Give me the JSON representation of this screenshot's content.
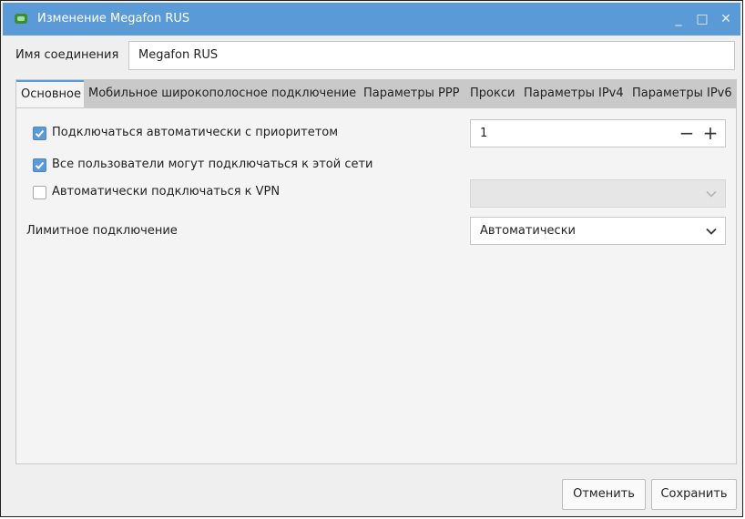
{
  "window": {
    "title": "Изменение Megafon RUS",
    "titlebar_color": "#5a9ad6",
    "controls": {
      "minimize": "_",
      "maximize": "□",
      "close": "✕"
    }
  },
  "connection": {
    "label": "Имя соединения",
    "value": "Megafon RUS"
  },
  "tabs": [
    {
      "label": "Основное",
      "active": true
    },
    {
      "label": "Мобильное широкополосное подключение",
      "active": false
    },
    {
      "label": "Параметры PPP",
      "active": false
    },
    {
      "label": "Прокси",
      "active": false
    },
    {
      "label": "Параметры IPv4",
      "active": false
    },
    {
      "label": "Параметры IPv6",
      "active": false
    }
  ],
  "general": {
    "auto_connect": {
      "label": "Подключаться автоматически с приоритетом",
      "checked": true
    },
    "priority": {
      "value": "1",
      "minus": "−",
      "plus": "+"
    },
    "all_users": {
      "label": "Все пользователи могут подключаться к этой сети",
      "checked": true
    },
    "auto_vpn": {
      "label": "Автоматически подключаться к VPN",
      "checked": false,
      "selected": ""
    },
    "metered": {
      "label": "Лимитное подключение",
      "selected": "Автоматически"
    }
  },
  "buttons": {
    "cancel": "Отменить",
    "save": "Сохранить"
  }
}
